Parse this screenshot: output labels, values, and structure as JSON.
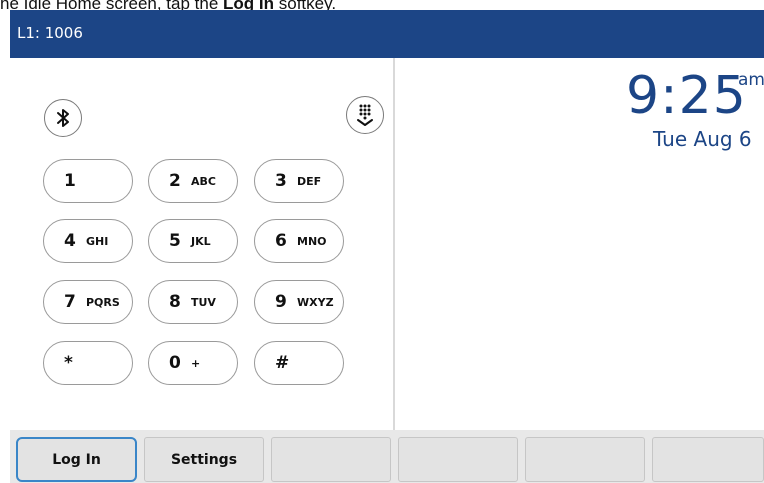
{
  "caption": {
    "prefix": "he Idle Home screen, tap the ",
    "bold": "Log In",
    "suffix": " softkey."
  },
  "header": {
    "line_label": "L1: 1006"
  },
  "icons": {
    "bluetooth": "bluetooth-icon",
    "dialpad_toggle": "dialpad-collapse-icon"
  },
  "dialpad": {
    "keys": [
      {
        "digit": "1",
        "letters": ""
      },
      {
        "digit": "2",
        "letters": "ABC"
      },
      {
        "digit": "3",
        "letters": "DEF"
      },
      {
        "digit": "4",
        "letters": "GHI"
      },
      {
        "digit": "5",
        "letters": "JKL"
      },
      {
        "digit": "6",
        "letters": "MNO"
      },
      {
        "digit": "7",
        "letters": "PQRS"
      },
      {
        "digit": "8",
        "letters": "TUV"
      },
      {
        "digit": "9",
        "letters": "WXYZ"
      },
      {
        "digit": "*",
        "letters": ""
      },
      {
        "digit": "0",
        "letters": "+"
      },
      {
        "digit": "#",
        "letters": ""
      }
    ]
  },
  "clock": {
    "time": "9:25",
    "ampm": "am",
    "date": "Tue Aug 6"
  },
  "softkeys": [
    {
      "label": "Log In"
    },
    {
      "label": "Settings"
    },
    {
      "label": ""
    },
    {
      "label": ""
    },
    {
      "label": ""
    },
    {
      "label": ""
    }
  ],
  "colors": {
    "header_bg": "#1c4586",
    "accent": "#1c4586",
    "focus": "#3a86c8"
  }
}
